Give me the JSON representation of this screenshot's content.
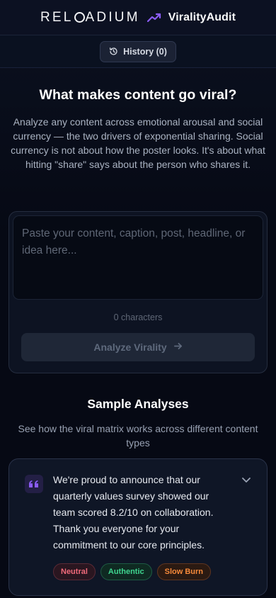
{
  "header": {
    "brand_left": "REL",
    "brand_right": "ADIUM",
    "product_name": "ViralityAudit",
    "accent_color": "#8b5cf6"
  },
  "history": {
    "label": "History (0)",
    "icon": "history-icon"
  },
  "hero": {
    "title": "What makes content go viral?",
    "description": "Analyze any content across emotional arousal and social currency — the two drivers of exponential sharing. Social currency is not about how the poster looks. It's about what hitting \"share\" says about the person who shares it."
  },
  "input": {
    "placeholder": "Paste your content, caption, post, headline, or idea here...",
    "char_count": "0 characters",
    "analyze_label": "Analyze Virality",
    "analyze_icon": "arrow-right-icon"
  },
  "samples": {
    "title": "Sample Analyses",
    "description": "See how the viral matrix works across different content types",
    "items": [
      {
        "text": "We're proud to announce that our quarterly values survey showed our team scored 8.2/10 on collaboration. Thank you everyone for your commitment to our core principles.",
        "tags": [
          {
            "label": "Neutral",
            "color": "#f06a7a"
          },
          {
            "label": "Authentic",
            "color": "#3fd690"
          },
          {
            "label": "Slow Burn",
            "color": "#f6893a"
          }
        ]
      }
    ]
  }
}
